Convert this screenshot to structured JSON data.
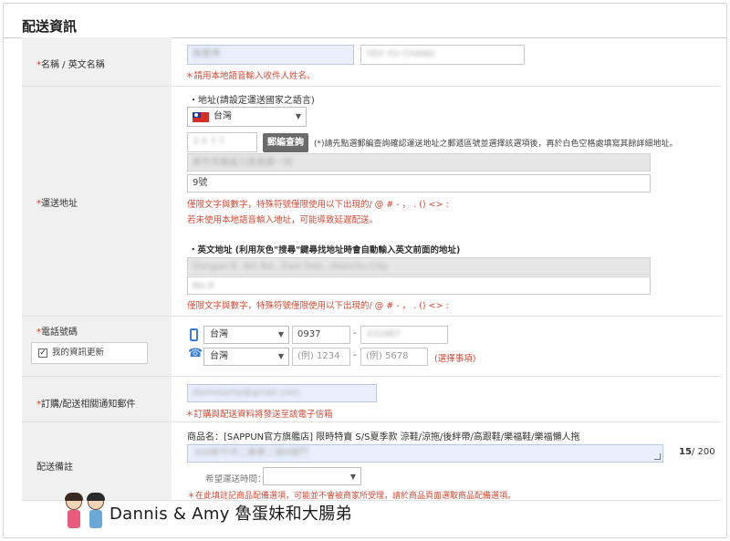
{
  "section_title": "配送資訊",
  "name_row": {
    "label": "名稱 / 英文名稱",
    "name_value": "陳曹博",
    "english_value": "YEH YU CHANG",
    "note": "＊請用本地語音輸入收件人姓名。"
  },
  "address_row": {
    "label": "運送地址",
    "local_heading": "・地址(請設定運送國家之語言)",
    "country": "台灣",
    "zip_value": "3  0 7 7",
    "zip_button": "郵編查詢",
    "zip_hint": "(*)請先點選郵編查詢確認運送地址之郵遞區號並選擇該選項後，再於白色空格處填寫其餘詳細地址。",
    "auto_address": "新竹市東區三民路第一段",
    "detail_value": "9號",
    "note_chars": "僅限文字與數字，特殊符號僅限使用以下出現的/ @ # - ， . () <> :",
    "note_local": "若未使用本地語音輸入地址，可能導致延遲配送。",
    "english_heading": "・英文地址 (利用灰色\"搜尋\"鍵尋找地址時會自動輸入英文前面的地址)",
    "english_auto": "Dongan E. 4th Rd., East Dist., Hsinchu City",
    "english_detail": "No.9",
    "note_chars_2": "僅限文字與數字，特殊符號僅限使用以下出現的/ @ # - ， . () <> :"
  },
  "phone_row": {
    "label": "電話號碼",
    "update_checkbox": "我的資訊更新",
    "mobile_country": "台灣",
    "mobile_prefix": "0937",
    "mobile_number": "331987",
    "tel_country": "台灣",
    "tel_area_placeholder": "(例) 1234",
    "tel_number_placeholder": "(例) 5678",
    "tel_optional": "(選擇事項)",
    "dash": "-"
  },
  "email_row": {
    "label": "訂購/配送相關通知郵件",
    "email_value": "dannisamy@gmail.com",
    "note": "＊訂購與配送資料將發送至該電子信箱"
  },
  "remark_row": {
    "label": "配送備註",
    "product_label": "商品名：",
    "product_name": "[SAPPUN官方旗艦店] 限時特賣 S/S夏季款 涼鞋/涼拖/後絆帶/高跟鞋/樂福鞋/樂福懶人拖",
    "remark_value": "300新竹市二東東二號8號門",
    "char_count": "15",
    "char_limit": "/ 200",
    "time_label": "希望運送時間：",
    "note": "＊在此填註記商品配備選項，可能並不會被商家所受理，請於商品頁面選取商品配備選項。"
  },
  "footer": {
    "brand": "Dannis & Amy 魯蛋妹和大腸弟"
  },
  "colors": {
    "accent_red": "#d24a35",
    "label_bg": "#f0f0f0",
    "focus_blue": "#e8effd",
    "button_gray": "#6b6b6b"
  }
}
